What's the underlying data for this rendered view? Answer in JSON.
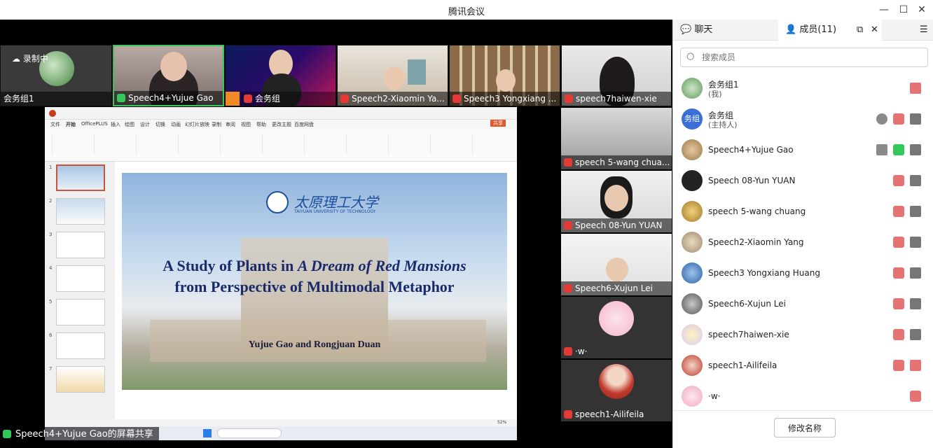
{
  "window": {
    "title": "腾讯会议"
  },
  "stage": {
    "top_tiles": [
      {
        "name": "会务组1",
        "badge": "录制中"
      },
      {
        "name": "Speech4+Yujue Gao"
      },
      {
        "name": "会务组"
      },
      {
        "name": "Speech2-Xiaomin Ya..."
      },
      {
        "name": "Speech3 Yongxiang ..."
      },
      {
        "name": "speech7haiwen-xie"
      }
    ],
    "side_tiles": [
      {
        "name": "speech 5-wang chua..."
      },
      {
        "name": "Speech 08-Yun YUAN"
      },
      {
        "name": "Speech6-Xujun Lei"
      },
      {
        "name": "·w·"
      },
      {
        "name": "speech1-Ailifeila"
      }
    ],
    "share_label": "Speech4+Yujue Gao的屏幕共享"
  },
  "slide": {
    "university": "太原理工大学",
    "university_en": "TAIYUAN UNIVERSITY OF TECHNOLOGY",
    "title_line1_pre": "A Study of Plants in ",
    "title_line1_em": "A Dream of Red Mansions",
    "title_line2": "from Perspective of Multimodal Metaphor",
    "authors": "Yujue Gao and Rongjuan Duan"
  },
  "ppt": {
    "menu": [
      "文件",
      "开始",
      "OfficePLUS",
      "插入",
      "绘图",
      "设计",
      "切换",
      "动画",
      "幻灯片放映",
      "录制",
      "审阅",
      "视图",
      "帮助",
      "更改主题",
      "百度网盘"
    ],
    "share_button": "共享",
    "thumbs": [
      "1",
      "2",
      "3",
      "4",
      "5",
      "6",
      "7"
    ],
    "zoom": "52%"
  },
  "panel": {
    "tab_chat": "聊天",
    "tab_members": "成员(11)",
    "search_placeholder": "搜索成员",
    "members": [
      {
        "name": "会务组1",
        "role": "(我)"
      },
      {
        "name": "会务组",
        "role": "(主持人)",
        "avatar_text": "务组"
      },
      {
        "name": "Speech4+Yujue Gao"
      },
      {
        "name": "Speech 08-Yun YUAN"
      },
      {
        "name": "speech 5-wang chuang"
      },
      {
        "name": "Speech2-Xiaomin Yang"
      },
      {
        "name": "Speech3 Yongxiang Huang"
      },
      {
        "name": "Speech6-Xujun Lei"
      },
      {
        "name": "speech7haiwen-xie"
      },
      {
        "name": "speech1-Ailifeila"
      },
      {
        "name": "·w·"
      }
    ],
    "rename_button": "修改名称"
  },
  "colors": {
    "accent_green": "#34c759",
    "mic_red": "#e53935",
    "host_blue": "#3a6fd8"
  }
}
